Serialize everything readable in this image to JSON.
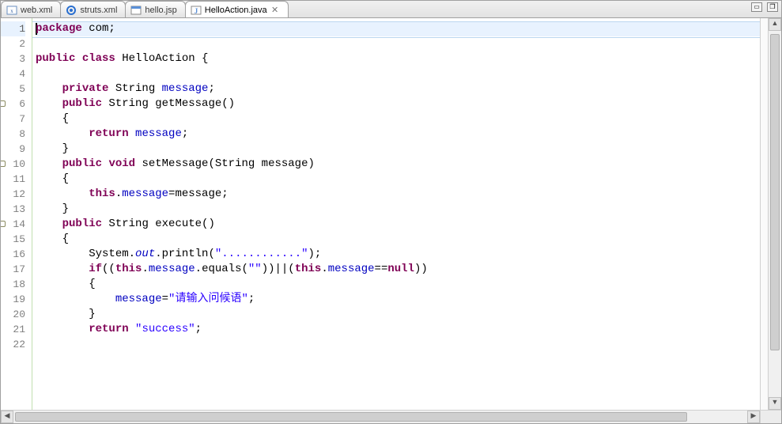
{
  "tabs": [
    {
      "label": "web.xml",
      "icon": "xml"
    },
    {
      "label": "struts.xml",
      "icon": "struts"
    },
    {
      "label": "hello.jsp",
      "icon": "jsp"
    },
    {
      "label": "HelloAction.java",
      "icon": "java",
      "active": true
    }
  ],
  "code": {
    "lines": [
      {
        "n": "1",
        "hl": true,
        "frag": [
          [
            "kw",
            "package"
          ],
          [
            "plain",
            " com;"
          ]
        ]
      },
      {
        "n": "2",
        "frag": [
          [
            "plain",
            ""
          ]
        ]
      },
      {
        "n": "3",
        "frag": [
          [
            "kw",
            "public"
          ],
          [
            "plain",
            " "
          ],
          [
            "kw",
            "class"
          ],
          [
            "plain",
            " HelloAction {"
          ]
        ]
      },
      {
        "n": "4",
        "frag": [
          [
            "plain",
            ""
          ]
        ]
      },
      {
        "n": "5",
        "frag": [
          [
            "plain",
            "    "
          ],
          [
            "kw",
            "private"
          ],
          [
            "plain",
            " String "
          ],
          [
            "fld",
            "message"
          ],
          [
            "plain",
            ";"
          ]
        ]
      },
      {
        "n": "6",
        "marker": true,
        "frag": [
          [
            "plain",
            "    "
          ],
          [
            "kw",
            "public"
          ],
          [
            "plain",
            " String getMessage()"
          ]
        ]
      },
      {
        "n": "7",
        "frag": [
          [
            "plain",
            "    {"
          ]
        ]
      },
      {
        "n": "8",
        "frag": [
          [
            "plain",
            "        "
          ],
          [
            "kw",
            "return"
          ],
          [
            "plain",
            " "
          ],
          [
            "fld",
            "message"
          ],
          [
            "plain",
            ";"
          ]
        ]
      },
      {
        "n": "9",
        "frag": [
          [
            "plain",
            "    }"
          ]
        ]
      },
      {
        "n": "10",
        "marker": true,
        "frag": [
          [
            "plain",
            "    "
          ],
          [
            "kw",
            "public"
          ],
          [
            "plain",
            " "
          ],
          [
            "kw",
            "void"
          ],
          [
            "plain",
            " setMessage(String message)"
          ]
        ]
      },
      {
        "n": "11",
        "frag": [
          [
            "plain",
            "    {"
          ]
        ]
      },
      {
        "n": "12",
        "frag": [
          [
            "plain",
            "        "
          ],
          [
            "kw",
            "this"
          ],
          [
            "plain",
            "."
          ],
          [
            "fld",
            "message"
          ],
          [
            "plain",
            "=message;"
          ]
        ]
      },
      {
        "n": "13",
        "frag": [
          [
            "plain",
            "    }"
          ]
        ]
      },
      {
        "n": "14",
        "marker": true,
        "frag": [
          [
            "plain",
            "    "
          ],
          [
            "kw",
            "public"
          ],
          [
            "plain",
            " String execute()"
          ]
        ]
      },
      {
        "n": "15",
        "frag": [
          [
            "plain",
            "    {"
          ]
        ]
      },
      {
        "n": "16",
        "frag": [
          [
            "plain",
            "        System."
          ],
          [
            "sfld",
            "out"
          ],
          [
            "plain",
            ".println("
          ],
          [
            "str",
            "\"............\""
          ],
          [
            "plain",
            ");"
          ]
        ]
      },
      {
        "n": "17",
        "frag": [
          [
            "plain",
            "        "
          ],
          [
            "kw",
            "if"
          ],
          [
            "plain",
            "(("
          ],
          [
            "kw",
            "this"
          ],
          [
            "plain",
            "."
          ],
          [
            "fld",
            "message"
          ],
          [
            "plain",
            ".equals("
          ],
          [
            "str",
            "\"\""
          ],
          [
            "plain",
            "))||("
          ],
          [
            "kw",
            "this"
          ],
          [
            "plain",
            "."
          ],
          [
            "fld",
            "message"
          ],
          [
            "plain",
            "=="
          ],
          [
            "kw",
            "null"
          ],
          [
            "plain",
            "))"
          ]
        ]
      },
      {
        "n": "18",
        "frag": [
          [
            "plain",
            "        {"
          ]
        ]
      },
      {
        "n": "19",
        "frag": [
          [
            "plain",
            "            "
          ],
          [
            "fld",
            "message"
          ],
          [
            "plain",
            "="
          ],
          [
            "str",
            "\"请输入问候语\""
          ],
          [
            "plain",
            ";"
          ]
        ]
      },
      {
        "n": "20",
        "frag": [
          [
            "plain",
            "        }"
          ]
        ]
      },
      {
        "n": "21",
        "frag": [
          [
            "plain",
            "        "
          ],
          [
            "kw",
            "return"
          ],
          [
            "plain",
            " "
          ],
          [
            "str",
            "\"success\""
          ],
          [
            "plain",
            ";"
          ]
        ]
      },
      {
        "n": "22",
        "frag": [
          [
            "plain",
            ""
          ]
        ]
      }
    ]
  },
  "icons": {
    "close_glyph": "✕",
    "min": "▭",
    "max": "❐"
  }
}
